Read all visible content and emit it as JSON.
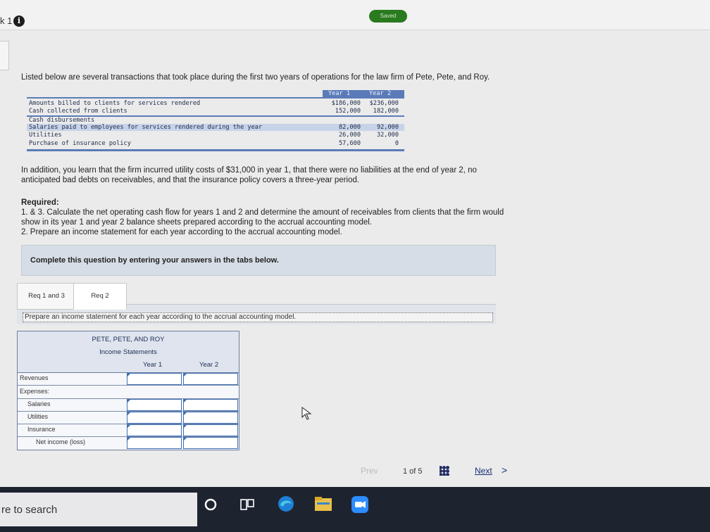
{
  "header": {
    "question_label": "k 1",
    "info_icon": "i",
    "saved_label": "Saved"
  },
  "intro": "Listed below are several transactions that took place during the first two years of operations for the law firm of Pete, Pete, and Roy.",
  "transactions": {
    "col_year1": "Year 1",
    "col_year2": "Year 2",
    "rows": [
      {
        "label": "Amounts billed to clients for services rendered",
        "y1": "$186,000",
        "y2": "$236,000"
      },
      {
        "label": "Cash collected from clients",
        "y1": "152,000",
        "y2": "182,000"
      },
      {
        "label": "Cash disbursements",
        "y1": "",
        "y2": ""
      },
      {
        "label": "Salaries paid to employees for services rendered during the year",
        "y1": "82,000",
        "y2": "92,000"
      },
      {
        "label": "Utilities",
        "y1": "26,000",
        "y2": "32,000"
      },
      {
        "label": "Purchase of insurance policy",
        "y1": "57,600",
        "y2": "0"
      }
    ]
  },
  "addition_text_1": "In addition, you learn that the firm incurred utility costs of $31,000 in year 1, that there were no liabilities at the end of year 2, no",
  "addition_text_2": "anticipated bad debts on receivables, and that the insurance policy covers a three-year period.",
  "required": {
    "title": "Required:",
    "line1": "1. & 3. Calculate the net operating cash flow for years 1 and 2 and determine the amount of receivables from clients that the firm would",
    "line2": "show in its year 1 and year 2 balance sheets prepared according to the accrual accounting model.",
    "line3": "2. Prepare an income statement for each year according to the accrual accounting model."
  },
  "complete_box": "Complete this question by entering your answers in the tabs below.",
  "tabs": [
    {
      "label": "Req 1 and 3",
      "active": false
    },
    {
      "label": "Req 2",
      "active": true
    }
  ],
  "instruction": "Prepare an income statement for each year according to the accrual accounting model.",
  "income_statement": {
    "company": "PETE, PETE, AND ROY",
    "title": "Income Statements",
    "col_year1": "Year 1",
    "col_year2": "Year 2",
    "rows": [
      {
        "label": "Revenues",
        "indent": 0
      },
      {
        "label": "Expenses:",
        "indent": 0
      },
      {
        "label": "Salaries",
        "indent": 1
      },
      {
        "label": "Utilities",
        "indent": 1
      },
      {
        "label": "Insurance",
        "indent": 1
      },
      {
        "label": "Net income (loss)",
        "indent": 2
      }
    ]
  },
  "pagination": {
    "prev": "Prev",
    "page": "1 of 5",
    "next": "Next",
    "chevron": ">"
  },
  "taskbar": {
    "search_text": "re to search"
  },
  "colors": {
    "saved_badge": "#2a7a1f",
    "table_header": "#5b7bb8",
    "nav_link": "#1a2f77"
  }
}
